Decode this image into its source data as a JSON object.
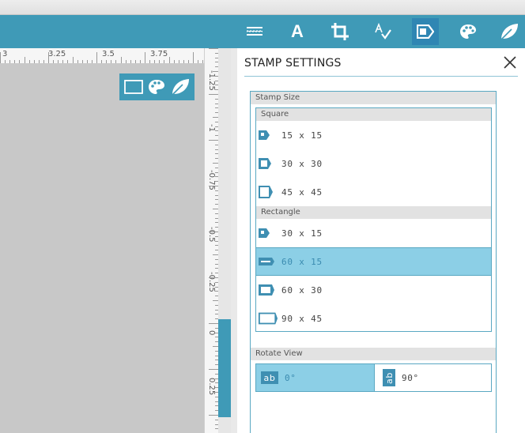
{
  "toolbar": {
    "icons": [
      "lines-icon",
      "text-icon",
      "crop-icon",
      "spell-icon",
      "stamp-icon",
      "palette-icon",
      "leaf-icon"
    ],
    "text_glyph": "A",
    "active_icon": "stamp-icon"
  },
  "ruler": {
    "horizontal": [
      "3",
      "3.25",
      "3.5",
      "3.75"
    ],
    "vertical": [
      "-1.25",
      "-1",
      "-0.75",
      "-0.5",
      "-0.25",
      "0",
      "0.25"
    ]
  },
  "panel": {
    "title": "STAMP SETTINGS",
    "stamp_size": {
      "label": "Stamp Size",
      "square_label": "Square",
      "square": [
        "15 x 15",
        "30 x 30",
        "45 x 45"
      ],
      "rectangle_label": "Rectangle",
      "rectangle": [
        "30 x 15",
        "60 x 15",
        "60 x 30",
        "90 x 45"
      ],
      "selected": "60 x 15"
    },
    "rotate_view": {
      "label": "Rotate View",
      "options": [
        "0°",
        "90°"
      ],
      "badge": "ab",
      "selected": "0°"
    }
  },
  "colors": {
    "accent": "#3f9ab7",
    "selected": "#8ccfe6",
    "canvas": "#c8c8c8"
  }
}
